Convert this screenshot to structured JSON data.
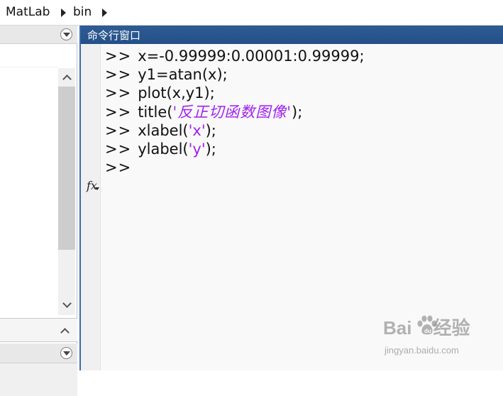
{
  "breadcrumb": {
    "items": [
      "MatLab",
      "bin"
    ]
  },
  "command_window": {
    "title": "命令行窗口",
    "prompt": ">>",
    "lines": [
      {
        "code": "x=-0.99999:0.00001:0.99999;"
      },
      {
        "code": "y1=atan(x);"
      },
      {
        "code": "plot(x,y1);"
      },
      {
        "pre": "title(",
        "str": "'反正切函数图像'",
        "post": ");"
      },
      {
        "pre": "xlabel(",
        "str": "'x'",
        "post": ");"
      },
      {
        "pre": "ylabel(",
        "str": "'y'",
        "post": ");"
      },
      {
        "code": ""
      }
    ],
    "fx_icon": "fx-function-browser-icon"
  },
  "colors": {
    "titlebar": "#2f5c93",
    "string": "#a020f0",
    "panel_border": "#3b6ea8"
  },
  "watermark": {
    "brand_left": "Bai",
    "brand_right": "经验",
    "url": "jingyan.baidu.com"
  }
}
